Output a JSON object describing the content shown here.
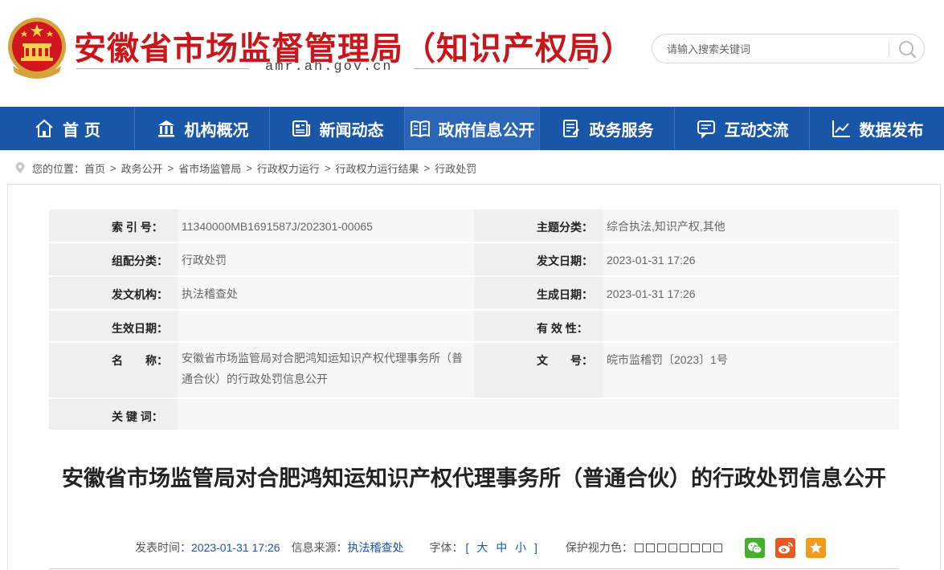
{
  "header": {
    "site_title": "安徽省市场监督管理局（知识产权局）",
    "site_domain": "amr.ah.gov.cn",
    "search_placeholder": "请输入搜索关键词"
  },
  "nav": {
    "items": [
      {
        "label": "首 页",
        "icon": "home-icon"
      },
      {
        "label": "机构概况",
        "icon": "building-icon"
      },
      {
        "label": "新闻动态",
        "icon": "newspaper-icon"
      },
      {
        "label": "政府信息公开",
        "icon": "open-book-icon"
      },
      {
        "label": "政务服务",
        "icon": "form-icon"
      },
      {
        "label": "互动交流",
        "icon": "chat-icon"
      },
      {
        "label": "数据发布",
        "icon": "chart-icon"
      }
    ],
    "active_index": 3
  },
  "breadcrumb": {
    "prefix": "您的位置：",
    "items": [
      "首页",
      "政务公开",
      "省市场监管局",
      "行政权力运行",
      "行政权力运行结果",
      "行政处罚"
    ]
  },
  "meta": {
    "index_label": "索 引 号：",
    "index_value": "11340000MB1691587J/202301-00065",
    "topic_label": "主题分类：",
    "topic_value": "综合执法,知识产权,其他",
    "group_label": "组配分类：",
    "group_value": "行政处罚",
    "pubdate_label": "发文日期：",
    "pubdate_value": "2023-01-31 17:26",
    "org_label": "发文机构：",
    "org_value": "执法稽查处",
    "gendate_label": "生成日期：",
    "gendate_value": "2023-01-31 17:26",
    "effdate_label": "生效日期：",
    "effdate_value": "",
    "validity_label": "有 效 性：",
    "validity_value": "",
    "name_label": "名　　称：",
    "name_value": "安徽省市场监管局对合肥鸿知运知识产权代理事务所（普通合伙）的行政处罚信息公开",
    "docno_label": "文　　号：",
    "docno_value": "皖市监稽罚〔2023〕1号",
    "keywords_label": "关 键 词：",
    "keywords_value": ""
  },
  "article": {
    "title": "安徽省市场监管局对合肥鸿知运知识产权代理事务所（普通合伙）的行政处罚信息公开",
    "publish_label": "发表时间：",
    "publish_time": "2023-01-31 17:26",
    "source_label": "信息来源：",
    "source_value": "执法稽查处",
    "font_label": "字体：",
    "font_open": "[",
    "font_large": "大",
    "font_medium": "中",
    "font_small": "小",
    "font_close": "]",
    "eye_label": "保护视力色："
  },
  "colors": {
    "brand_red": "#c8161d",
    "nav_blue": "#1a56a8",
    "wechat_green": "#43b02a",
    "weibo_orange": "#e9581f",
    "favorite_yellow": "#f29b1c"
  }
}
